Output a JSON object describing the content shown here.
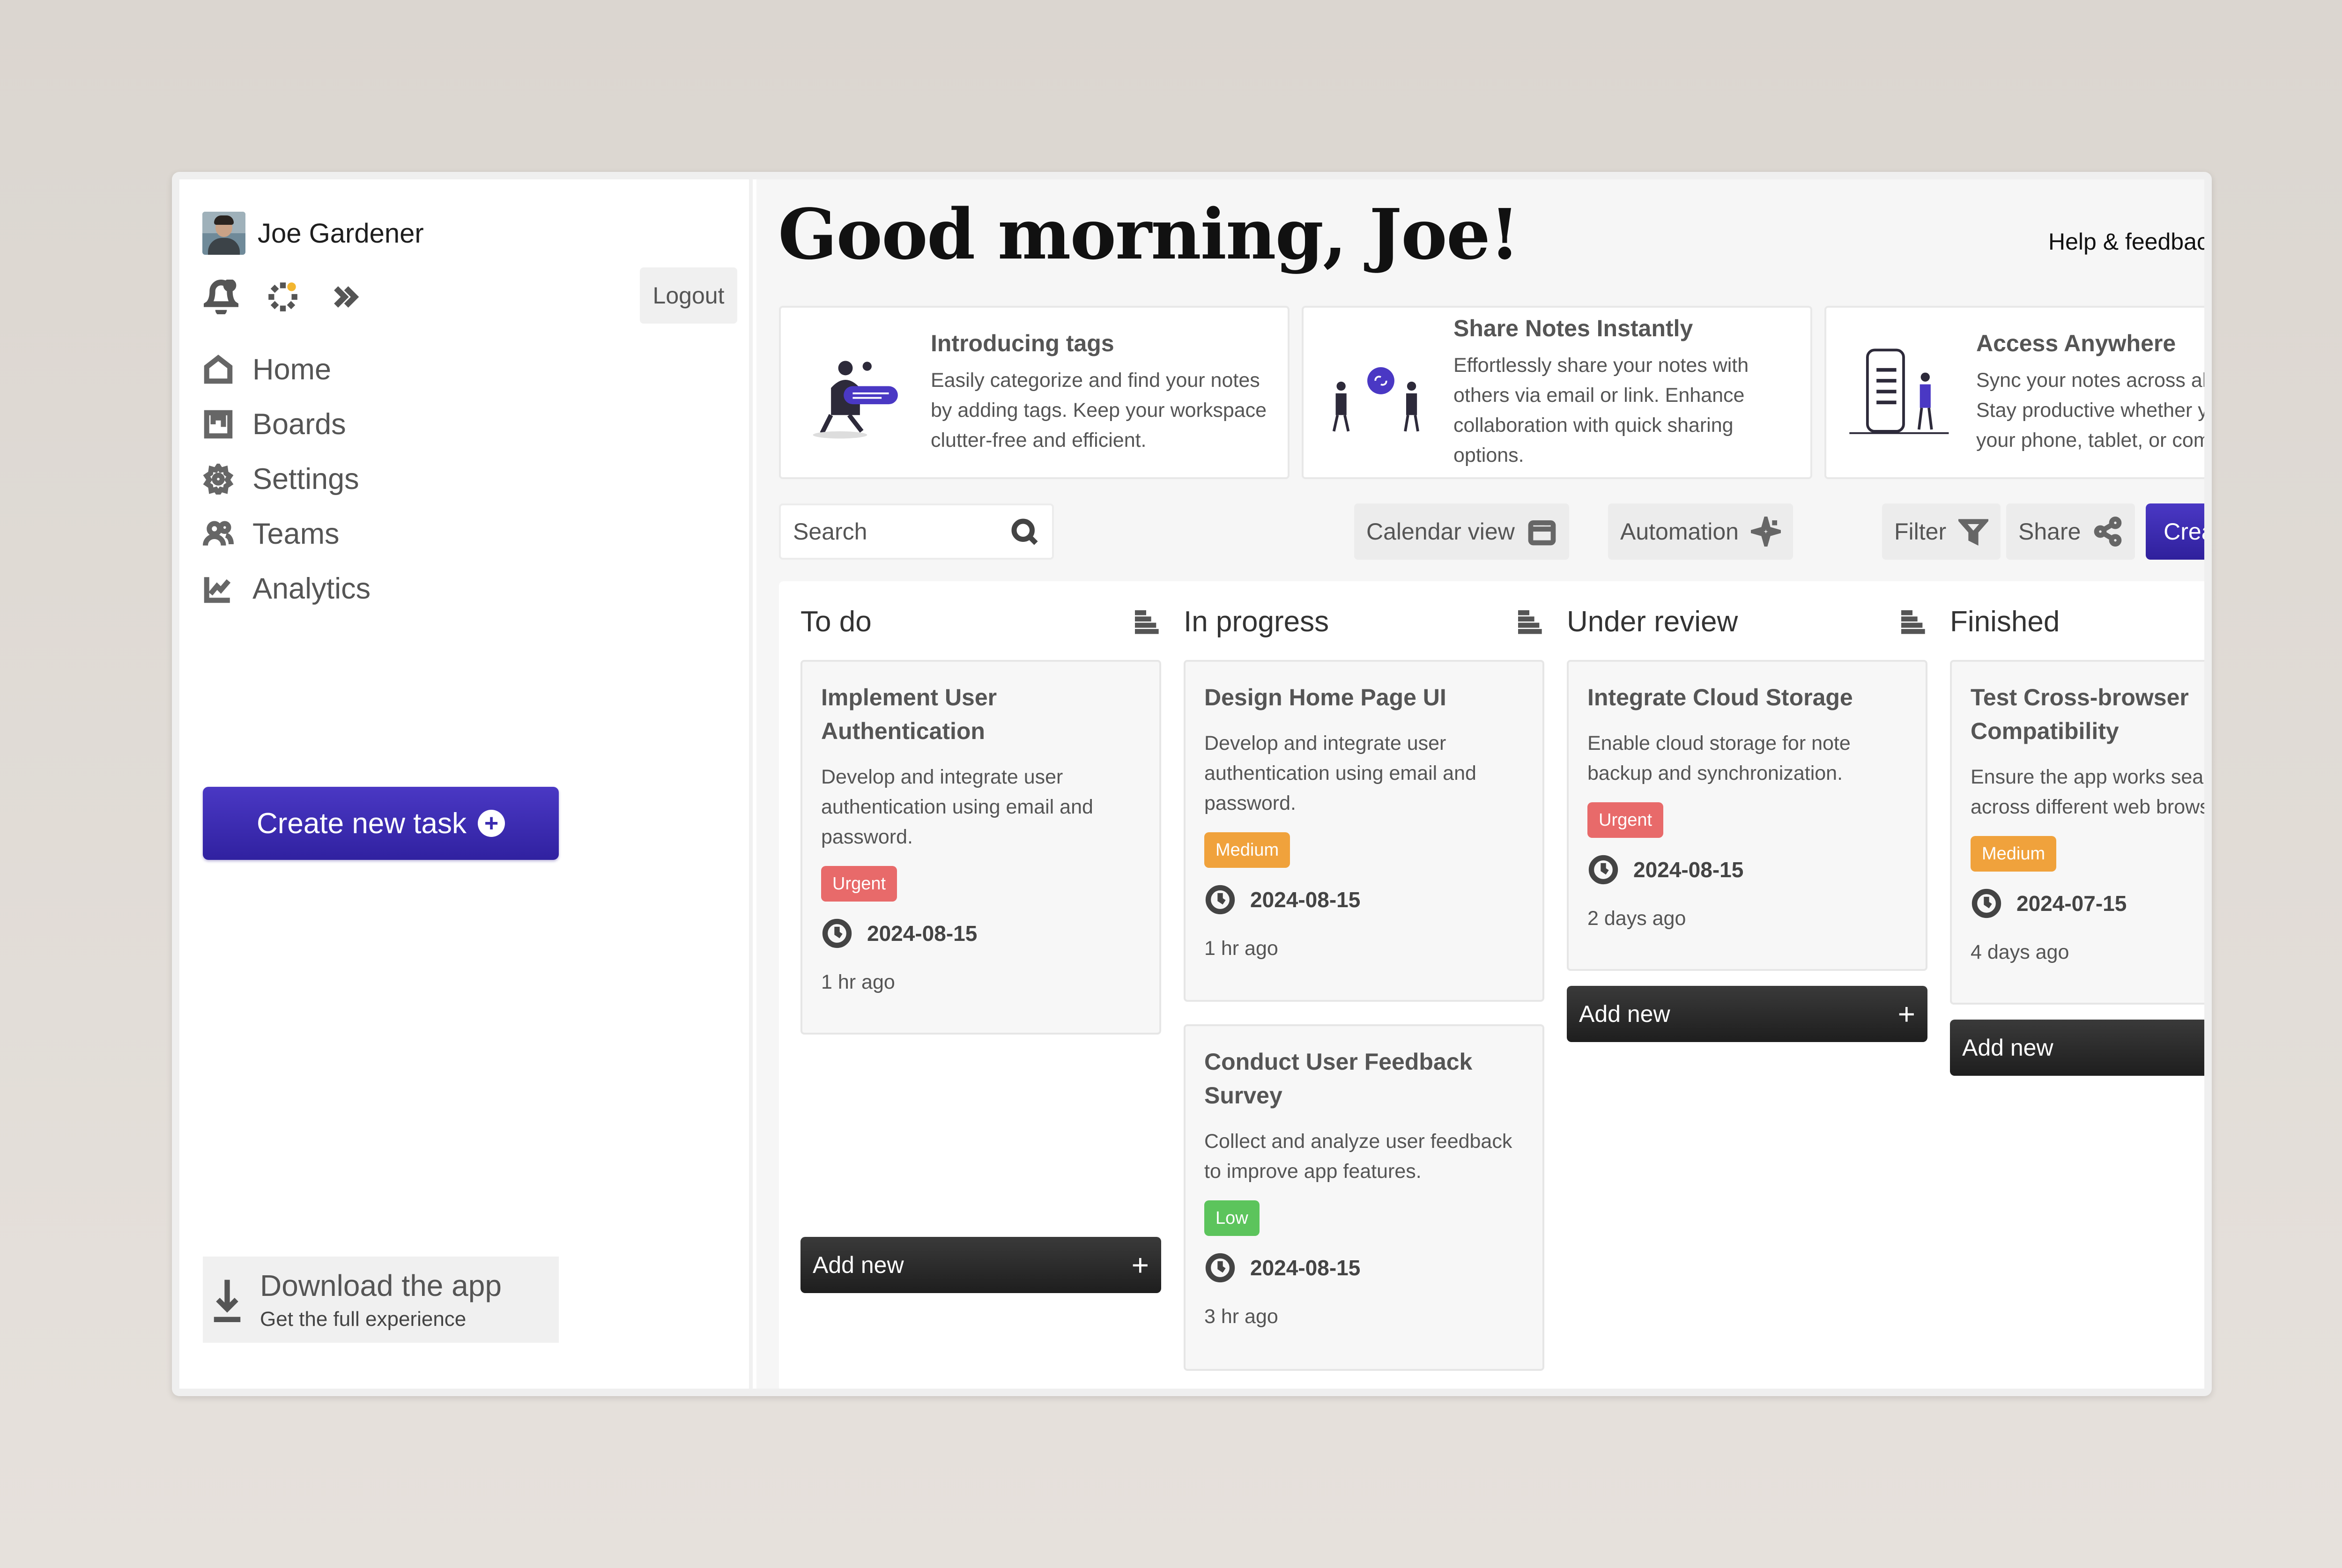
{
  "user": {
    "name": "Joe Gardener"
  },
  "sidebar": {
    "logout_label": "Logout",
    "icons": [
      "bell-icon",
      "loader-icon",
      "chevrons-right-icon"
    ],
    "nav": [
      {
        "label": "Home",
        "icon": "home-icon"
      },
      {
        "label": "Boards",
        "icon": "board-icon"
      },
      {
        "label": "Settings",
        "icon": "gear-icon"
      },
      {
        "label": "Teams",
        "icon": "users-icon"
      },
      {
        "label": "Analytics",
        "icon": "chart-icon"
      }
    ],
    "create_task_label": "Create new task",
    "download": {
      "title": "Download the app",
      "subtitle": "Get the full experience"
    }
  },
  "header": {
    "greeting": "Good morning, Joe!",
    "help_label": "Help & feedback"
  },
  "feature_cards": [
    {
      "title": "Introducing tags",
      "description": "Easily categorize and find your notes by adding tags. Keep your workspace clutter-free and efficient."
    },
    {
      "title": "Share Notes Instantly",
      "description": "Effortlessly share your notes with others via email or link. Enhance collaboration with quick sharing options."
    },
    {
      "title": "Access Anywhere",
      "description": "Sync your notes across all devices. Stay productive whether you're on your phone, tablet, or computer."
    }
  ],
  "toolbar": {
    "search_placeholder": "Search",
    "calendar_label": "Calendar view",
    "automation_label": "Automation",
    "filter_label": "Filter",
    "share_label": "Share",
    "create_new_label": "Create new"
  },
  "colors": {
    "accent": "#3a2bb0",
    "urgent": "#e86a6a",
    "medium": "#f0a23c",
    "low": "#5cc45c"
  },
  "board": {
    "add_new_label": "Add new",
    "columns": [
      {
        "title": "To do",
        "tasks": [
          {
            "title": "Implement User Authentication",
            "description": "Develop and integrate user authentication using email and password.",
            "priority": "Urgent",
            "date": "2024-08-15",
            "ago": "1 hr ago"
          }
        ]
      },
      {
        "title": "In progress",
        "tasks": [
          {
            "title": "Design Home Page UI",
            "description": "Develop and integrate user authentication using email and password.",
            "priority": "Medium",
            "date": "2024-08-15",
            "ago": "1 hr ago"
          },
          {
            "title": "Conduct User Feedback Survey",
            "description": "Collect and analyze user feedback to improve app features.",
            "priority": "Low",
            "date": "2024-08-15",
            "ago": "3 hr ago"
          }
        ]
      },
      {
        "title": "Under review",
        "tasks": [
          {
            "title": "Integrate Cloud Storage",
            "description": "Enable cloud storage for note backup and synchronization.",
            "priority": "Urgent",
            "date": "2024-08-15",
            "ago": "2 days ago"
          }
        ]
      },
      {
        "title": "Finished",
        "tasks": [
          {
            "title": "Test Cross-browser Compatibility",
            "description": "Ensure the app works seamlessly across different web browsers.",
            "priority": "Medium",
            "date": "2024-07-15",
            "ago": "4 days ago"
          }
        ]
      }
    ]
  }
}
